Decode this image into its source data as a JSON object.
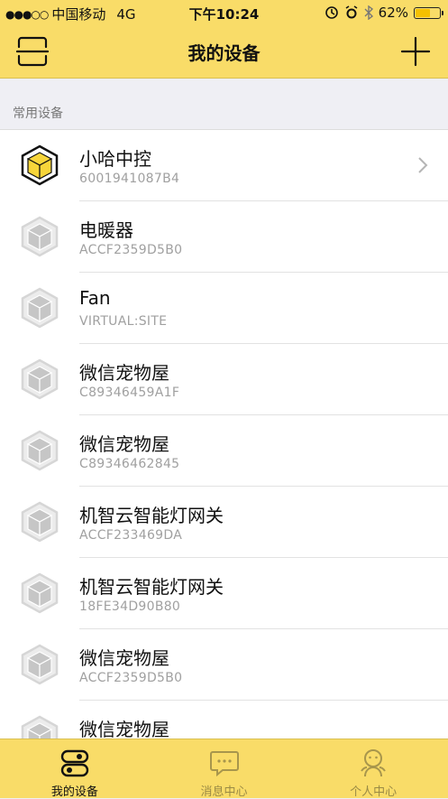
{
  "status_bar": {
    "carrier": "中国移动",
    "network": "4G",
    "time": "下午10:24",
    "battery_text": "62%",
    "battery_level": 0.62,
    "icons": [
      "signal-dots-icon",
      "alarm-icon",
      "clock-icon",
      "bluetooth-icon",
      "battery-icon"
    ]
  },
  "nav": {
    "title": "我的设备",
    "left_icon": "scan-icon",
    "right_icon": "plus-icon"
  },
  "section": {
    "title": "常用设备"
  },
  "devices": [
    {
      "name": "小哈中控",
      "id": "6001941087B4",
      "active": true
    },
    {
      "name": "电暖器",
      "id": "ACCF2359D5B0",
      "active": false
    },
    {
      "name": "Fan",
      "id": "VIRTUAL:SITE",
      "active": false
    },
    {
      "name": "微信宠物屋",
      "id": "C89346459A1F",
      "active": false
    },
    {
      "name": "微信宠物屋",
      "id": "C89346462845",
      "active": false
    },
    {
      "name": "机智云智能灯网关",
      "id": "ACCF233469DA",
      "active": false
    },
    {
      "name": "机智云智能灯网关",
      "id": "18FE34D90B80",
      "active": false
    },
    {
      "name": "微信宠物屋",
      "id": "ACCF2359D5B0",
      "active": false
    },
    {
      "name": "微信宠物屋",
      "id": "",
      "active": false
    }
  ],
  "tabs": [
    {
      "label": "我的设备",
      "icon": "device-tab-icon",
      "active": true
    },
    {
      "label": "消息中心",
      "icon": "message-tab-icon",
      "active": false
    },
    {
      "label": "个人中心",
      "icon": "profile-tab-icon",
      "active": false
    }
  ],
  "colors": {
    "accent": "#f9dc68",
    "device_active": "#f7d53a",
    "device_inactive": "#c6c6c6"
  }
}
